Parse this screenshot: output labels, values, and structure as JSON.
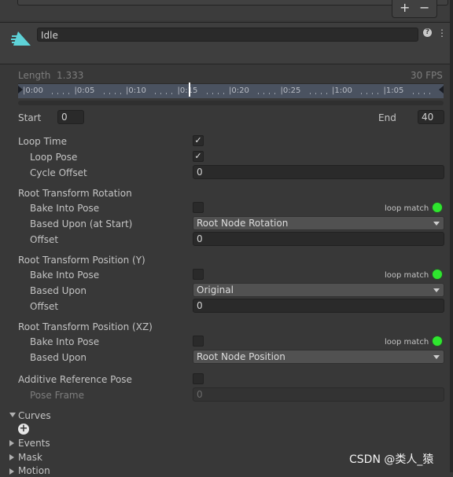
{
  "toolbar": {
    "add_label": "+",
    "remove_label": "−"
  },
  "header": {
    "clip_name": "Idle",
    "help_glyph": "?",
    "settings_glyph": "⋮",
    "clip_icon": "animation-clip-icon"
  },
  "timeline": {
    "length_label": "Length",
    "length_value": "1.333",
    "fps": "30 FPS",
    "ticks": [
      "0:00",
      "0:05",
      "0:10",
      "0:15",
      "0:20",
      "0:25",
      "1:00",
      "1:05"
    ]
  },
  "range": {
    "start_label": "Start",
    "start_value": "0",
    "end_label": "End",
    "end_value": "40"
  },
  "loop": {
    "loop_time_label": "Loop Time",
    "loop_time_checked": true,
    "loop_pose_label": "Loop Pose",
    "loop_pose_checked": true,
    "cycle_offset_label": "Cycle Offset",
    "cycle_offset_value": "0"
  },
  "rotation": {
    "title": "Root Transform Rotation",
    "bake_label": "Bake Into Pose",
    "loop_match": "loop match",
    "based_upon_label": "Based Upon (at Start)",
    "based_upon_value": "Root Node Rotation",
    "offset_label": "Offset",
    "offset_value": "0"
  },
  "position_y": {
    "title": "Root Transform Position (Y)",
    "bake_label": "Bake Into Pose",
    "loop_match": "loop match",
    "based_upon_label": "Based Upon",
    "based_upon_value": "Original",
    "offset_label": "Offset",
    "offset_value": "0"
  },
  "position_xz": {
    "title": "Root Transform Position (XZ)",
    "bake_label": "Bake Into Pose",
    "loop_match": "loop match",
    "based_upon_label": "Based Upon",
    "based_upon_value": "Root Node Position"
  },
  "additive": {
    "label": "Additive Reference Pose",
    "pose_frame_label": "Pose Frame",
    "pose_frame_value": "0"
  },
  "sections": {
    "curves": "Curves",
    "events": "Events",
    "mask": "Mask",
    "motion": "Motion"
  },
  "watermark": "CSDN @类人_猿",
  "colors": {
    "loop_match_ok": "#2ee62e",
    "timeline_bg": "#4a5260",
    "panel_bg": "#383838",
    "clip_icon": "#5ed3d8"
  }
}
